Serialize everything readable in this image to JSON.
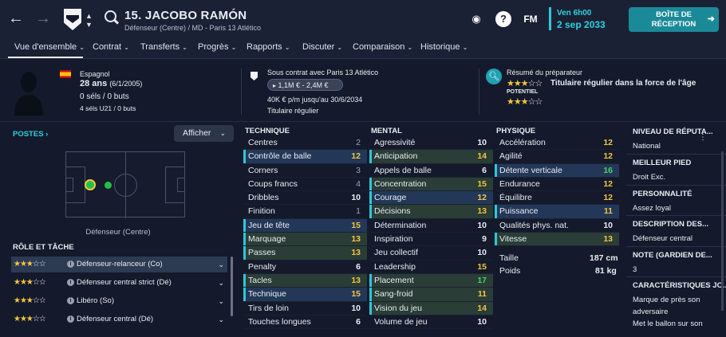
{
  "header": {
    "player_title": "15. JACOBO RAMÓN",
    "player_subtitle": "Défenseur (Centre) / MD - Paris 13 Atlético",
    "date_day": "Ven 6h00",
    "date": "2 sep 2033",
    "inbox_line1": "BOÎTE DE",
    "inbox_line2": "RÉCEPTION",
    "fm_label": "FM"
  },
  "tabs": [
    "Vue d'ensemble",
    "Contrat",
    "Transferts",
    "Progrès",
    "Rapports",
    "Discuter",
    "Comparaison",
    "Historique"
  ],
  "profile": {
    "nationality": "Espagnol",
    "age": "28 ans",
    "birth": "(6/1/2005)",
    "caps": "0 séls / 0 buts",
    "u21": "4 séls U21 / 0 buts",
    "contract_label": "Sous contrat avec Paris 13 Atlético",
    "value_range": "1,1M € - 2,4M €",
    "wage": "40K € p/m jusqu'au 30/6/2034",
    "status": "Titulaire régulier",
    "coach_summary_label": "Résumé du préparateur",
    "coach_summary": "Titulaire régulier dans la force de l'âge",
    "potential_label": "POTENTIEL",
    "ability_stars": 3,
    "potential_stars": 3
  },
  "positions": {
    "title": "POSTES",
    "dropdown": "Afficher",
    "position_label": "Défenseur (Centre)"
  },
  "roles": {
    "title": "RÔLE ET TÂCHE",
    "items": [
      {
        "name": "Défenseur-relanceur (Co)",
        "stars": 3,
        "selected": true
      },
      {
        "name": "Défenseur central strict (Dé)",
        "stars": 3,
        "selected": false
      },
      {
        "name": "Libéro (So)",
        "stars": 3,
        "selected": false
      },
      {
        "name": "Défenseur central (Dé)",
        "stars": 3,
        "selected": false
      }
    ]
  },
  "technique": {
    "title": "TECHNIQUE",
    "rows": [
      {
        "name": "Centres",
        "value": "2",
        "hl": ""
      },
      {
        "name": "Contrôle de balle",
        "value": "12",
        "hl": "h"
      },
      {
        "name": "Corners",
        "value": "3",
        "hl": ""
      },
      {
        "name": "Coups francs",
        "value": "4",
        "hl": ""
      },
      {
        "name": "Dribbles",
        "value": "10",
        "hl": ""
      },
      {
        "name": "Finition",
        "value": "1",
        "hl": ""
      },
      {
        "name": "Jeu de tête",
        "value": "15",
        "hl": "h"
      },
      {
        "name": "Marquage",
        "value": "13",
        "hl": "g"
      },
      {
        "name": "Passes",
        "value": "13",
        "hl": "g"
      },
      {
        "name": "Penalty",
        "value": "6",
        "hl": ""
      },
      {
        "name": "Tacles",
        "value": "13",
        "hl": "g"
      },
      {
        "name": "Technique",
        "value": "15",
        "hl": "h"
      },
      {
        "name": "Tirs de loin",
        "value": "10",
        "hl": ""
      },
      {
        "name": "Touches longues",
        "value": "6",
        "hl": ""
      }
    ]
  },
  "mental": {
    "title": "MENTAL",
    "rows": [
      {
        "name": "Agressivité",
        "value": "10",
        "hl": ""
      },
      {
        "name": "Anticipation",
        "value": "14",
        "hl": "g"
      },
      {
        "name": "Appels de balle",
        "value": "6",
        "hl": ""
      },
      {
        "name": "Concentration",
        "value": "15",
        "hl": "g"
      },
      {
        "name": "Courage",
        "value": "12",
        "hl": "h"
      },
      {
        "name": "Décisions",
        "value": "13",
        "hl": "g"
      },
      {
        "name": "Détermination",
        "value": "10",
        "hl": ""
      },
      {
        "name": "Inspiration",
        "value": "9",
        "hl": ""
      },
      {
        "name": "Jeu collectif",
        "value": "10",
        "hl": ""
      },
      {
        "name": "Leadership",
        "value": "15",
        "hl": ""
      },
      {
        "name": "Placement",
        "value": "17",
        "hl": "g"
      },
      {
        "name": "Sang-froid",
        "value": "11",
        "hl": "g"
      },
      {
        "name": "Vision du jeu",
        "value": "14",
        "hl": "g"
      },
      {
        "name": "Volume de jeu",
        "value": "10",
        "hl": ""
      }
    ]
  },
  "physique": {
    "title": "PHYSIQUE",
    "rows": [
      {
        "name": "Accélération",
        "value": "12",
        "hl": ""
      },
      {
        "name": "Agilité",
        "value": "12",
        "hl": ""
      },
      {
        "name": "Détente verticale",
        "value": "16",
        "hl": "h"
      },
      {
        "name": "Endurance",
        "value": "12",
        "hl": ""
      },
      {
        "name": "Équilibre",
        "value": "12",
        "hl": ""
      },
      {
        "name": "Puissance",
        "value": "11",
        "hl": "h"
      },
      {
        "name": "Qualités phys. nat.",
        "value": "10",
        "hl": ""
      },
      {
        "name": "Vitesse",
        "value": "13",
        "hl": "g"
      }
    ],
    "height_label": "Taille",
    "height": "187 cm",
    "weight_label": "Poids",
    "weight": "81 kg"
  },
  "side_info": [
    {
      "title": "NIVEAU DE RÉPUTA...",
      "value": "National"
    },
    {
      "title": "MEILLEUR PIED",
      "value": "Droit Exc."
    },
    {
      "title": "PERSONNALITÉ",
      "value": "Assez loyal"
    },
    {
      "title": "DESCRIPTION DES...",
      "value": "Défenseur central"
    },
    {
      "title": "NOTE (GARDIEN DE...",
      "value": "3"
    },
    {
      "title": "CARACTÉRISTIQUES JO...",
      "value": "Marque de près son adversaire|Met le ballon sur son"
    }
  ],
  "colors": {
    "accent": "#2fd0df",
    "highlight_blue": "#233858",
    "highlight_green": "#2a3d36",
    "value_yellow": "#f5c542",
    "value_green": "#48d36a"
  }
}
